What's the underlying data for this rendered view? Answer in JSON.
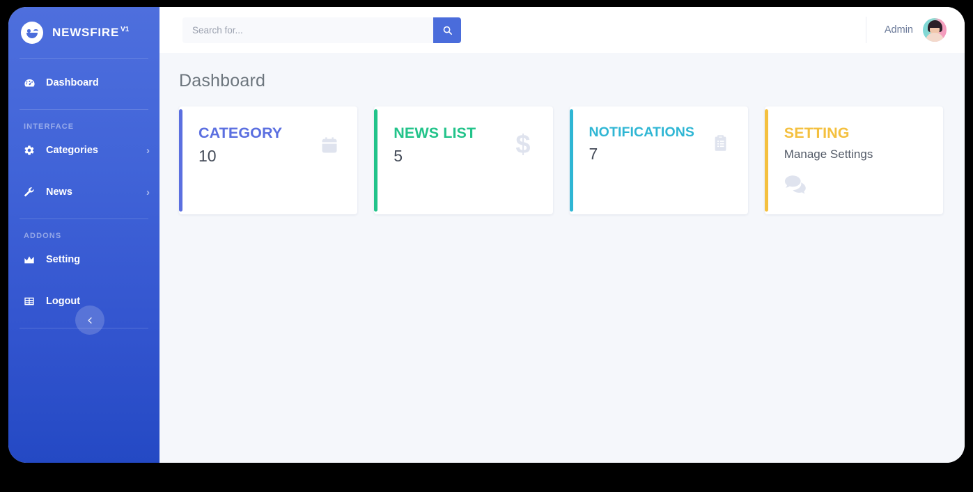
{
  "brand": {
    "name": "NEWSFIRE",
    "version": "V1",
    "logo_icon": "smiley-wink-icon"
  },
  "sidebar": {
    "items": [
      {
        "label": "Dashboard",
        "icon": "dashboard-gauge-icon",
        "caret": ""
      },
      {
        "label": "Categories",
        "icon": "gear-icon",
        "caret": "›"
      },
      {
        "label": "News",
        "icon": "wrench-icon",
        "caret": "›"
      },
      {
        "label": "Setting",
        "icon": "area-chart-icon",
        "caret": ""
      },
      {
        "label": "Logout",
        "icon": "table-grid-icon",
        "caret": ""
      }
    ],
    "sections": {
      "interface": "INTERFACE",
      "addons": "ADDONS"
    },
    "collapse_icon": "chevron-left-icon"
  },
  "header": {
    "search": {
      "placeholder": "Search for...",
      "value": "",
      "button_icon": "search-icon"
    },
    "user": {
      "name": "Admin",
      "avatar": "user-avatar"
    }
  },
  "main": {
    "page_title": "Dashboard",
    "cards": [
      {
        "title": "CATEGORY",
        "value": "10",
        "subtitle": "",
        "icon": "calendar-icon",
        "color": "#5b6fe0",
        "icon_position": "right"
      },
      {
        "title": "NEWS LIST",
        "value": "5",
        "subtitle": "",
        "icon": "dollar-sign-icon",
        "color": "#22c38a",
        "icon_position": "right"
      },
      {
        "title": "NOTIFICATIONS",
        "value": "7",
        "subtitle": "",
        "icon": "clipboard-list-icon",
        "color": "#2fb6d4",
        "icon_position": "right"
      },
      {
        "title": "SETTING",
        "value": "",
        "subtitle": "Manage Settings",
        "icon": "comments-icon",
        "color": "#f4c03f",
        "icon_position": "below"
      }
    ]
  }
}
